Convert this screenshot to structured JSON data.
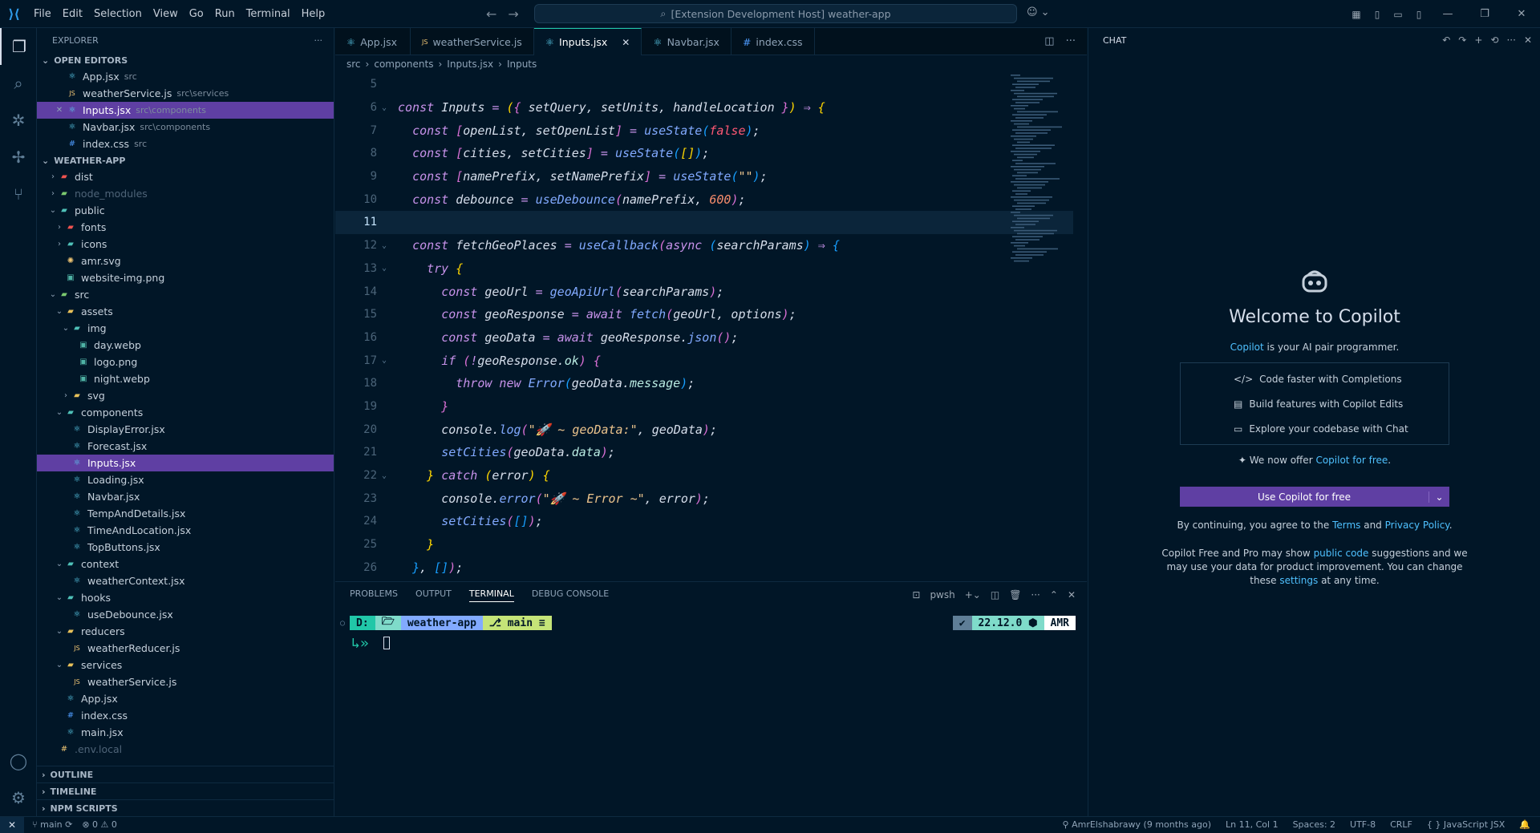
{
  "menu": [
    "File",
    "Edit",
    "Selection",
    "View",
    "Go",
    "Run",
    "Terminal",
    "Help"
  ],
  "command_center": "[Extension Development Host] weather-app",
  "explorer": {
    "title": "EXPLORER",
    "open_editors_label": "OPEN EDITORS",
    "open_editors": [
      {
        "name": "App.jsx",
        "desc": "src",
        "icon": "react"
      },
      {
        "name": "weatherService.js",
        "desc": "src\\services",
        "icon": "js"
      },
      {
        "name": "Inputs.jsx",
        "desc": "src\\components",
        "icon": "react",
        "selected": true,
        "close": "✕"
      },
      {
        "name": "Navbar.jsx",
        "desc": "src\\components",
        "icon": "react"
      },
      {
        "name": "index.css",
        "desc": "src",
        "icon": "css"
      }
    ],
    "project_label": "WEATHER-APP",
    "tree": [
      {
        "name": "dist",
        "depth": 1,
        "chev": "›",
        "icon": "fold-red"
      },
      {
        "name": "node_modules",
        "depth": 1,
        "chev": "›",
        "icon": "fold-green",
        "dim": true
      },
      {
        "name": "public",
        "depth": 1,
        "chev": "⌄",
        "icon": "fold-teal"
      },
      {
        "name": "fonts",
        "depth": 2,
        "chev": "›",
        "icon": "fold-red"
      },
      {
        "name": "icons",
        "depth": 2,
        "chev": "›",
        "icon": "fold-teal"
      },
      {
        "name": "amr.svg",
        "depth": 2,
        "icon": "svg"
      },
      {
        "name": "website-img.png",
        "depth": 2,
        "icon": "img"
      },
      {
        "name": "src",
        "depth": 1,
        "chev": "⌄",
        "icon": "fold-green"
      },
      {
        "name": "assets",
        "depth": 2,
        "chev": "⌄",
        "icon": "folder"
      },
      {
        "name": "img",
        "depth": 3,
        "chev": "⌄",
        "icon": "fold-teal"
      },
      {
        "name": "day.webp",
        "depth": 4,
        "icon": "img"
      },
      {
        "name": "logo.png",
        "depth": 4,
        "icon": "img"
      },
      {
        "name": "night.webp",
        "depth": 4,
        "icon": "img"
      },
      {
        "name": "svg",
        "depth": 3,
        "chev": "›",
        "icon": "folder"
      },
      {
        "name": "components",
        "depth": 2,
        "chev": "⌄",
        "icon": "fold-teal"
      },
      {
        "name": "DisplayError.jsx",
        "depth": 3,
        "icon": "react"
      },
      {
        "name": "Forecast.jsx",
        "depth": 3,
        "icon": "react"
      },
      {
        "name": "Inputs.jsx",
        "depth": 3,
        "icon": "react",
        "selected": true
      },
      {
        "name": "Loading.jsx",
        "depth": 3,
        "icon": "react"
      },
      {
        "name": "Navbar.jsx",
        "depth": 3,
        "icon": "react"
      },
      {
        "name": "TempAndDetails.jsx",
        "depth": 3,
        "icon": "react"
      },
      {
        "name": "TimeAndLocation.jsx",
        "depth": 3,
        "icon": "react"
      },
      {
        "name": "TopButtons.jsx",
        "depth": 3,
        "icon": "react"
      },
      {
        "name": "context",
        "depth": 2,
        "chev": "⌄",
        "icon": "fold-teal"
      },
      {
        "name": "weatherContext.jsx",
        "depth": 3,
        "icon": "react"
      },
      {
        "name": "hooks",
        "depth": 2,
        "chev": "⌄",
        "icon": "fold-teal"
      },
      {
        "name": "useDebounce.jsx",
        "depth": 3,
        "icon": "react"
      },
      {
        "name": "reducers",
        "depth": 2,
        "chev": "⌄",
        "icon": "folder"
      },
      {
        "name": "weatherReducer.js",
        "depth": 3,
        "icon": "js"
      },
      {
        "name": "services",
        "depth": 2,
        "chev": "⌄",
        "icon": "folder"
      },
      {
        "name": "weatherService.js",
        "depth": 3,
        "icon": "js"
      },
      {
        "name": "App.jsx",
        "depth": 2,
        "icon": "react"
      },
      {
        "name": "index.css",
        "depth": 2,
        "icon": "css"
      },
      {
        "name": "main.jsx",
        "depth": 2,
        "icon": "react"
      },
      {
        "name": ".env.local",
        "depth": 1,
        "icon": "env",
        "dim": true
      }
    ],
    "bottom_sections": [
      "OUTLINE",
      "TIMELINE",
      "NPM SCRIPTS"
    ]
  },
  "tabs": [
    {
      "label": "App.jsx",
      "icon": "react"
    },
    {
      "label": "weatherService.js",
      "icon": "js"
    },
    {
      "label": "Inputs.jsx",
      "icon": "react",
      "active": true,
      "close": "✕"
    },
    {
      "label": "Navbar.jsx",
      "icon": "react"
    },
    {
      "label": "index.css",
      "icon": "css"
    }
  ],
  "breadcrumb": [
    "src",
    "components",
    "Inputs.jsx",
    "Inputs"
  ],
  "code": {
    "current_line": 11,
    "lines": [
      {
        "n": 5,
        "t": []
      },
      {
        "n": 6,
        "fold": "⌄",
        "t": [
          [
            "kw",
            "const "
          ],
          [
            "id",
            "Inputs "
          ],
          [
            "op",
            "= "
          ],
          [
            "br1",
            "("
          ],
          [
            "br2",
            "{ "
          ],
          [
            "id",
            "setQuery, setUnits, handleLocation "
          ],
          [
            "br2",
            "}"
          ],
          [
            "br1",
            ")"
          ],
          [
            "op",
            " ⇒ "
          ],
          [
            "br1",
            "{"
          ]
        ]
      },
      {
        "n": 7,
        "t": [
          [
            "ind",
            "  "
          ],
          [
            "kw",
            "const "
          ],
          [
            "br2",
            "["
          ],
          [
            "id",
            "openList, setOpenList"
          ],
          [
            "br2",
            "]"
          ],
          [
            "op",
            " = "
          ],
          [
            "fn",
            "useState"
          ],
          [
            "br3",
            "("
          ],
          [
            "bool",
            "false"
          ],
          [
            "br3",
            ")"
          ],
          [
            "id",
            ";"
          ]
        ]
      },
      {
        "n": 8,
        "t": [
          [
            "ind",
            "  "
          ],
          [
            "kw",
            "const "
          ],
          [
            "br2",
            "["
          ],
          [
            "id",
            "cities, setCities"
          ],
          [
            "br2",
            "]"
          ],
          [
            "op",
            " = "
          ],
          [
            "fn",
            "useState"
          ],
          [
            "br3",
            "("
          ],
          [
            "br1",
            "[]"
          ],
          [
            "br3",
            ")"
          ],
          [
            "id",
            ";"
          ]
        ]
      },
      {
        "n": 9,
        "t": [
          [
            "ind",
            "  "
          ],
          [
            "kw",
            "const "
          ],
          [
            "br2",
            "["
          ],
          [
            "id",
            "namePrefix, setNamePrefix"
          ],
          [
            "br2",
            "]"
          ],
          [
            "op",
            " = "
          ],
          [
            "fn",
            "useState"
          ],
          [
            "br3",
            "("
          ],
          [
            "str",
            "\"\""
          ],
          [
            "br3",
            ")"
          ],
          [
            "id",
            ";"
          ]
        ]
      },
      {
        "n": 10,
        "t": [
          [
            "ind",
            "  "
          ],
          [
            "kw",
            "const "
          ],
          [
            "id",
            "debounce "
          ],
          [
            "op",
            "= "
          ],
          [
            "fn",
            "useDebounce"
          ],
          [
            "br2",
            "("
          ],
          [
            "id",
            "namePrefix, "
          ],
          [
            "num",
            "600"
          ],
          [
            "br2",
            ")"
          ],
          [
            "id",
            ";"
          ]
        ]
      },
      {
        "n": 11,
        "t": []
      },
      {
        "n": 12,
        "fold": "⌄",
        "t": [
          [
            "ind",
            "  "
          ],
          [
            "kw",
            "const "
          ],
          [
            "id",
            "fetchGeoPlaces "
          ],
          [
            "op",
            "= "
          ],
          [
            "fn",
            "useCallback"
          ],
          [
            "br2",
            "("
          ],
          [
            "kw",
            "async "
          ],
          [
            "br3",
            "("
          ],
          [
            "id",
            "searchParams"
          ],
          [
            "br3",
            ")"
          ],
          [
            "op",
            " ⇒ "
          ],
          [
            "br3",
            "{"
          ]
        ]
      },
      {
        "n": 13,
        "fold": "⌄",
        "t": [
          [
            "ind",
            "    "
          ],
          [
            "kw",
            "try "
          ],
          [
            "br1",
            "{"
          ]
        ]
      },
      {
        "n": 14,
        "t": [
          [
            "ind",
            "      "
          ],
          [
            "kw",
            "const "
          ],
          [
            "id",
            "geoUrl "
          ],
          [
            "op",
            "= "
          ],
          [
            "fn",
            "geoApiUrl"
          ],
          [
            "br2",
            "("
          ],
          [
            "id",
            "searchParams"
          ],
          [
            "br2",
            ")"
          ],
          [
            "id",
            ";"
          ]
        ]
      },
      {
        "n": 15,
        "t": [
          [
            "ind",
            "      "
          ],
          [
            "kw",
            "const "
          ],
          [
            "id",
            "geoResponse "
          ],
          [
            "op",
            "= "
          ],
          [
            "kw",
            "await "
          ],
          [
            "fn",
            "fetch"
          ],
          [
            "br2",
            "("
          ],
          [
            "id",
            "geoUrl, options"
          ],
          [
            "br2",
            ")"
          ],
          [
            "id",
            ";"
          ]
        ]
      },
      {
        "n": 16,
        "t": [
          [
            "ind",
            "      "
          ],
          [
            "kw",
            "const "
          ],
          [
            "id",
            "geoData "
          ],
          [
            "op",
            "= "
          ],
          [
            "kw",
            "await "
          ],
          [
            "id",
            "geoResponse."
          ],
          [
            "fn",
            "json"
          ],
          [
            "br2",
            "()"
          ],
          [
            "id",
            ";"
          ]
        ]
      },
      {
        "n": 17,
        "fold": "⌄",
        "t": [
          [
            "ind",
            "      "
          ],
          [
            "kw",
            "if "
          ],
          [
            "br2",
            "("
          ],
          [
            "op",
            "!"
          ],
          [
            "id",
            "geoResponse."
          ],
          [
            "prop",
            "ok"
          ],
          [
            "br2",
            ") "
          ],
          [
            "br2",
            "{"
          ]
        ]
      },
      {
        "n": 18,
        "t": [
          [
            "ind",
            "        "
          ],
          [
            "kw",
            "throw new "
          ],
          [
            "fn",
            "Error"
          ],
          [
            "br3",
            "("
          ],
          [
            "id",
            "geoData."
          ],
          [
            "prop",
            "message"
          ],
          [
            "br3",
            ")"
          ],
          [
            "id",
            ";"
          ]
        ]
      },
      {
        "n": 19,
        "t": [
          [
            "ind",
            "      "
          ],
          [
            "br2",
            "}"
          ]
        ]
      },
      {
        "n": 20,
        "t": [
          [
            "ind",
            "      "
          ],
          [
            "id",
            "console."
          ],
          [
            "fn",
            "log"
          ],
          [
            "br2",
            "("
          ],
          [
            "str",
            "\"🚀 ~ geoData:\""
          ],
          [
            "id",
            ", geoData"
          ],
          [
            "br2",
            ")"
          ],
          [
            "id",
            ";"
          ]
        ]
      },
      {
        "n": 21,
        "t": [
          [
            "ind",
            "      "
          ],
          [
            "fn",
            "setCities"
          ],
          [
            "br2",
            "("
          ],
          [
            "id",
            "geoData."
          ],
          [
            "prop",
            "data"
          ],
          [
            "br2",
            ")"
          ],
          [
            "id",
            ";"
          ]
        ]
      },
      {
        "n": 22,
        "fold": "⌄",
        "t": [
          [
            "ind",
            "    "
          ],
          [
            "br1",
            "} "
          ],
          [
            "kw",
            "catch "
          ],
          [
            "br1",
            "("
          ],
          [
            "id",
            "error"
          ],
          [
            "br1",
            ") "
          ],
          [
            "br1",
            "{"
          ]
        ]
      },
      {
        "n": 23,
        "t": [
          [
            "ind",
            "      "
          ],
          [
            "id",
            "console."
          ],
          [
            "fn",
            "error"
          ],
          [
            "br2",
            "("
          ],
          [
            "str",
            "\"🚀 ~ Error ~\""
          ],
          [
            "id",
            ", error"
          ],
          [
            "br2",
            ")"
          ],
          [
            "id",
            ";"
          ]
        ]
      },
      {
        "n": 24,
        "t": [
          [
            "ind",
            "      "
          ],
          [
            "fn",
            "setCities"
          ],
          [
            "br2",
            "("
          ],
          [
            "br3",
            "[]"
          ],
          [
            "br2",
            ")"
          ],
          [
            "id",
            ";"
          ]
        ]
      },
      {
        "n": 25,
        "t": [
          [
            "ind",
            "    "
          ],
          [
            "br1",
            "}"
          ]
        ]
      },
      {
        "n": 26,
        "t": [
          [
            "ind",
            "  "
          ],
          [
            "br3",
            "}"
          ],
          [
            "id",
            ", "
          ],
          [
            "br3",
            "[]"
          ],
          [
            "br2",
            ")"
          ],
          [
            "id",
            ";"
          ]
        ]
      }
    ]
  },
  "panel": {
    "tabs": [
      "PROBLEMS",
      "OUTPUT",
      "TERMINAL",
      "DEBUG CONSOLE"
    ],
    "active_tab": "TERMINAL",
    "shell": "pwsh",
    "prompt_left": [
      "D:",
      "🗁",
      "weather-app",
      "⎇ main ≡"
    ],
    "prompt_right": [
      "✔",
      "22.12.0 ⬢",
      "AMR"
    ]
  },
  "chat": {
    "title": "CHAT",
    "welcome": "Welcome to Copilot",
    "sub_link": "Copilot",
    "sub_rest": " is your AI pair programmer.",
    "features": [
      {
        "icon": "</>",
        "label": "Code faster with Completions"
      },
      {
        "icon": "▤",
        "label": "Build features with Copilot Edits"
      },
      {
        "icon": "▭",
        "label": "Explore your codebase with Chat"
      }
    ],
    "offer_prefix": "✦ We now offer ",
    "offer_link": "Copilot for free",
    "offer_suffix": ".",
    "cta": "Use Copilot for free",
    "legal_1": "By continuing, you agree to the ",
    "legal_terms": "Terms",
    "legal_and": " and ",
    "legal_privacy": "Privacy Policy",
    "legal_end": ".",
    "legal2_a": "Copilot Free and Pro may show ",
    "legal2_link1": "public code",
    "legal2_b": " suggestions and we may use your data for product improvement. You can change these ",
    "legal2_link2": "settings",
    "legal2_c": " at any time."
  },
  "status": {
    "branch": "main",
    "errors": "0",
    "warnings": "0",
    "blame": "AmrElshabrawy (9 months ago)",
    "position": "Ln 11, Col 1",
    "spaces": "Spaces: 2",
    "encoding": "UTF-8",
    "eol": "CRLF",
    "language": "JavaScript JSX"
  },
  "colors": {
    "accent": "#5f3fa3",
    "bg": "#011627",
    "link": "#4fc1ff",
    "terminal_teal": "#21c7a8"
  }
}
